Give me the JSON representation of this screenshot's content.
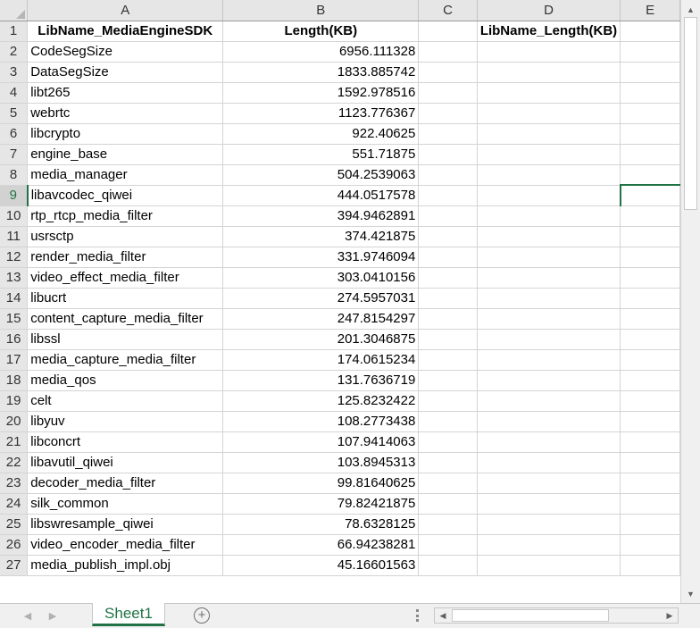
{
  "columns": [
    "A",
    "B",
    "C",
    "D",
    "E"
  ],
  "header_row": {
    "row": "1",
    "a": "LibName_MediaEngineSDK",
    "b": "Length(KB)",
    "d": "LibName_Length(KB)"
  },
  "rows": [
    {
      "row": "2",
      "name": "CodeSegSize",
      "length": "6956.111328"
    },
    {
      "row": "3",
      "name": "DataSegSize",
      "length": "1833.885742"
    },
    {
      "row": "4",
      "name": "libt265",
      "length": "1592.978516"
    },
    {
      "row": "5",
      "name": "webrtc",
      "length": "1123.776367"
    },
    {
      "row": "6",
      "name": "libcrypto",
      "length": "922.40625"
    },
    {
      "row": "7",
      "name": "engine_base",
      "length": "551.71875"
    },
    {
      "row": "8",
      "name": "media_manager",
      "length": "504.2539063"
    },
    {
      "row": "9",
      "name": "libavcodec_qiwei",
      "length": "444.0517578"
    },
    {
      "row": "10",
      "name": "rtp_rtcp_media_filter",
      "length": "394.9462891"
    },
    {
      "row": "11",
      "name": "usrsctp",
      "length": "374.421875"
    },
    {
      "row": "12",
      "name": "render_media_filter",
      "length": "331.9746094"
    },
    {
      "row": "13",
      "name": "video_effect_media_filter",
      "length": "303.0410156"
    },
    {
      "row": "14",
      "name": "libucrt",
      "length": "274.5957031"
    },
    {
      "row": "15",
      "name": "content_capture_media_filter",
      "length": "247.8154297"
    },
    {
      "row": "16",
      "name": "libssl",
      "length": "201.3046875"
    },
    {
      "row": "17",
      "name": "media_capture_media_filter",
      "length": "174.0615234"
    },
    {
      "row": "18",
      "name": "media_qos",
      "length": "131.7636719"
    },
    {
      "row": "19",
      "name": "celt",
      "length": "125.8232422"
    },
    {
      "row": "20",
      "name": "libyuv",
      "length": "108.2773438"
    },
    {
      "row": "21",
      "name": "libconcrt",
      "length": "107.9414063"
    },
    {
      "row": "22",
      "name": "libavutil_qiwei",
      "length": "103.8945313"
    },
    {
      "row": "23",
      "name": "decoder_media_filter",
      "length": "99.81640625"
    },
    {
      "row": "24",
      "name": "silk_common",
      "length": "79.82421875"
    },
    {
      "row": "25",
      "name": "libswresample_qiwei",
      "length": "78.6328125"
    },
    {
      "row": "26",
      "name": "video_encoder_media_filter",
      "length": "66.94238281"
    },
    {
      "row": "27",
      "name": "media_publish_impl.obj",
      "length": "45.16601563"
    }
  ],
  "active_row": "9",
  "sheet_tab": {
    "label": "Sheet1"
  },
  "icons": {
    "add_sheet": "plus-circle-icon",
    "scroll_up": "triangle-up-icon",
    "scroll_down": "triangle-down-icon",
    "scroll_left": "triangle-left-icon",
    "scroll_right": "triangle-right-icon"
  },
  "colors": {
    "accent": "#217346",
    "header_bg": "#e6e6e6",
    "gridline": "#d4d4d4"
  }
}
